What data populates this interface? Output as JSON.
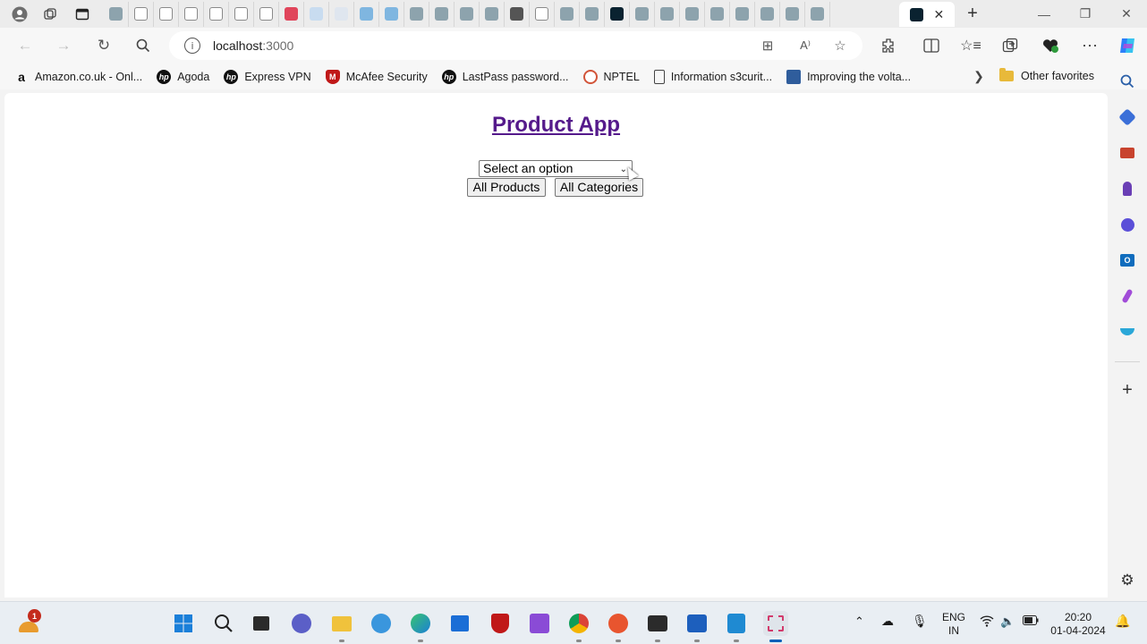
{
  "browser": {
    "address": {
      "host": "localhost",
      "port": ":3000"
    },
    "favorites": [
      {
        "label": "Amazon.co.uk - Onl...",
        "icon": "amazon-icon"
      },
      {
        "label": "Agoda",
        "icon": "hp-icon"
      },
      {
        "label": "Express VPN",
        "icon": "hp-icon"
      },
      {
        "label": "McAfee Security",
        "icon": "mcafee-icon"
      },
      {
        "label": "LastPass password...",
        "icon": "hp-icon"
      },
      {
        "label": "NPTEL",
        "icon": "nptel-icon"
      },
      {
        "label": "Information s3curit...",
        "icon": "page-icon"
      },
      {
        "label": "Improving the volta...",
        "icon": "doc-icon"
      }
    ],
    "other_favorites": "Other favorites",
    "read_aloud_glyph": "A⁾"
  },
  "page": {
    "title": "Product App",
    "select": {
      "selected": "Select an option"
    },
    "buttons": {
      "products": "All Products",
      "categories": "All Categories"
    }
  },
  "taskbar": {
    "notification_count": "1",
    "lang_line1": "ENG",
    "lang_line2": "IN",
    "time": "20:20",
    "date": "01-04-2024"
  },
  "colors": {
    "link_visited": "#551a8b",
    "accent": "#005fb8",
    "react_tab": "#0a2230"
  }
}
